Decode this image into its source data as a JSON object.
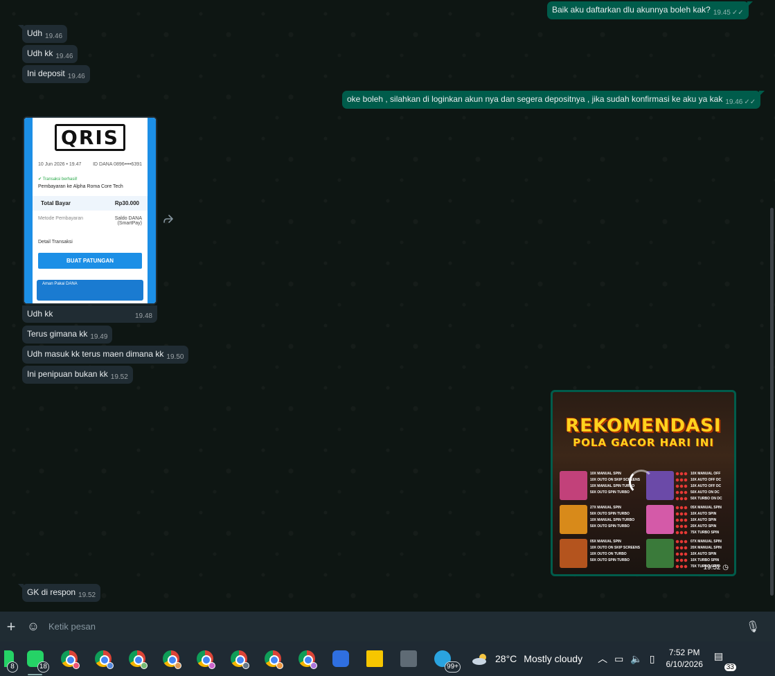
{
  "messages": [
    {
      "dir": "out",
      "text": "Baik aku daftarkan dlu akunnya boleh kak?",
      "time": "19.45",
      "ticks": "✓✓"
    },
    {
      "dir": "in",
      "text": "Udh",
      "time": "19.46"
    },
    {
      "dir": "in",
      "text": "Udh kk",
      "time": "19.46"
    },
    {
      "dir": "in",
      "text": "Ini deposit",
      "time": "19.46"
    },
    {
      "dir": "out",
      "text": "oke boleh , silahkan di loginkan akun nya dan segera depositnya , jika sudah konfirmasi ke aku ya kak",
      "time": "19.46",
      "ticks": "✓✓"
    },
    {
      "dir": "in",
      "text": "Udh kk",
      "time": "19.48"
    },
    {
      "dir": "in",
      "text": "Terus gimana kk",
      "time": "19.49"
    },
    {
      "dir": "in",
      "text": "Udh masuk kk terus maen dimana kk",
      "time": "19.50"
    },
    {
      "dir": "in",
      "text": "Ini penipuan bukan kk",
      "time": "19.52"
    },
    {
      "dir": "in",
      "text": "GK di respon",
      "time": "19.52"
    }
  ],
  "receipt": {
    "logo": "QRIS",
    "date": "10 Jun 2026 • 19.47",
    "id": "ID DANA 0896••••6391",
    "status": "Transaksi berhasil!",
    "merchant": "Pembayaran ke Alpha Roma Core Tech",
    "total_label": "Total Bayar",
    "total_value": "Rp30.000",
    "method_label": "Metode Pembayaran",
    "method_value": "Saldo DANA (SmartPay)",
    "detail_label": "Detail Transaksi",
    "button_label": "BUAT PATUNGAN",
    "promo_text": "Aman Pakai DANA"
  },
  "promo": {
    "title1": "REKOMENDASI",
    "title2": "POLA GACOR HARI INI",
    "time": "19.52",
    "games": [
      {
        "color": "#c2417a",
        "lines": [
          "10X MANUAL SPIN",
          "10X OUTO ON SKIP SCREENS",
          "10X MANUAL SPIN TURBO",
          "50X OUTO SPIN TURBO"
        ]
      },
      {
        "color": "#6b4aa8",
        "lines": [
          "10X MANUAL OFF",
          "10X AUTO OFF DC",
          "10X AUTO OFF DC",
          "50X AUTO ON DC",
          "50X TURBO ON DC"
        ]
      },
      {
        "color": "#d88a1a",
        "lines": [
          "27X MANUAL SPIN",
          "50X OUTO SPIN TURBO",
          "10X MANUAL SPIN TURBO",
          "50X OUTO SPIN TURBO"
        ]
      },
      {
        "color": "#d45aa8",
        "lines": [
          "05X MANUAL SPIN",
          "10X AUTO SPIN",
          "10X AUTO SPIN",
          "20X AUTO SPIN",
          "75X TURBO SPIN"
        ]
      },
      {
        "color": "#b4541e",
        "lines": [
          "05X MANUAL  SPIN",
          "10X OUTO ON SKIP SCREENS",
          "10X OUTO ON TURBO",
          "50X OUTO SPIN TURBO"
        ]
      },
      {
        "color": "#3a7a3a",
        "lines": [
          "07X MANUAL SPIN",
          "20X MANUAL SPIN",
          "10X AUTO SPIN",
          "10X TURBO SPIN",
          "70X TURBO SPIN"
        ]
      }
    ]
  },
  "compose": {
    "placeholder": "Ketik pesan"
  },
  "taskbar": {
    "badges": {
      "first": "8",
      "whatsapp": "18",
      "last": "99+"
    },
    "weather_temp": "28°C",
    "weather_text": "Mostly cloudy",
    "time": "7:52 PM",
    "date": "6/10/2026",
    "notif_count": "33"
  }
}
